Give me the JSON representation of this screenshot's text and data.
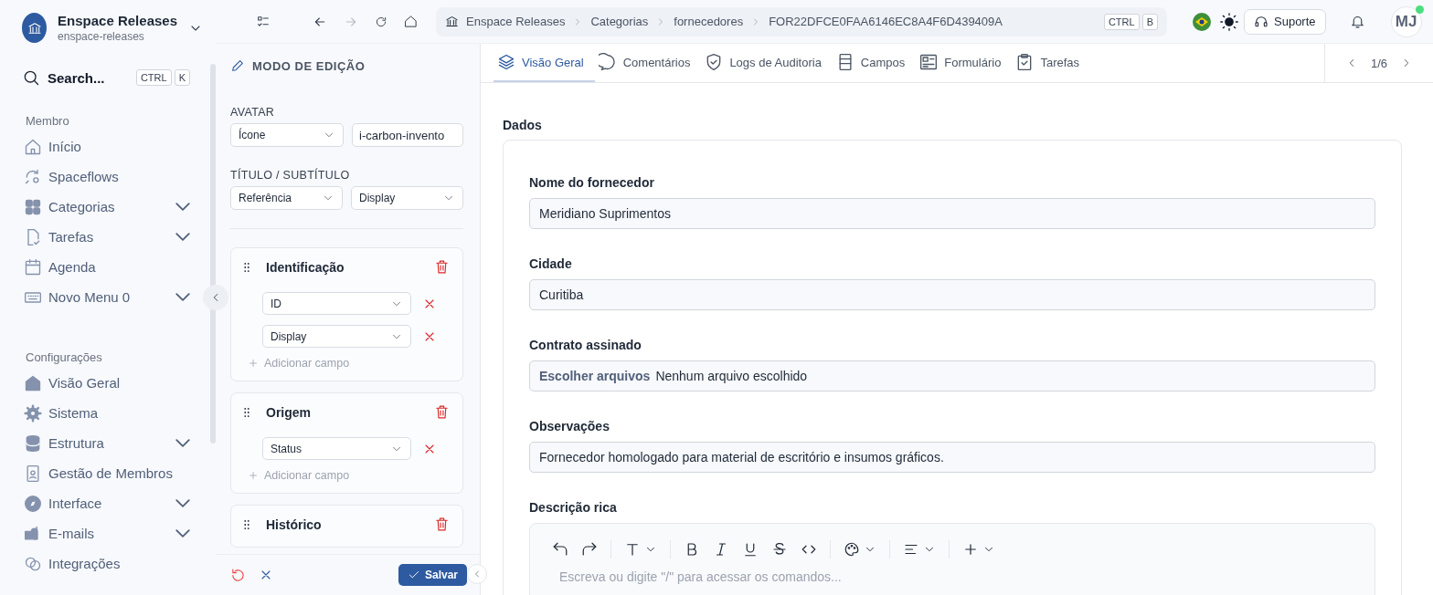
{
  "workspace": {
    "title": "Enspace Releases",
    "slug": "enspace-releases"
  },
  "search": {
    "label": "Search...",
    "keys": [
      "CTRL",
      "K"
    ]
  },
  "sidebar": {
    "groups": [
      {
        "title": "Membro",
        "items": [
          {
            "label": "Início",
            "kind": "home",
            "expandable": false
          },
          {
            "label": "Spaceflows",
            "kind": "flow",
            "expandable": false
          },
          {
            "label": "Categorias",
            "kind": "grid",
            "expandable": true
          },
          {
            "label": "Tarefas",
            "kind": "doc",
            "expandable": true
          },
          {
            "label": "Agenda",
            "kind": "calendar",
            "expandable": false
          },
          {
            "label": "Novo Menu 0",
            "kind": "keyboard",
            "expandable": true
          }
        ]
      },
      {
        "title": "Configurações",
        "items": [
          {
            "label": "Visão Geral",
            "kind": "house",
            "expandable": false
          },
          {
            "label": "Sistema",
            "kind": "gear",
            "expandable": false
          },
          {
            "label": "Estrutura",
            "kind": "database",
            "expandable": true
          },
          {
            "label": "Gestão de Membros",
            "kind": "badge",
            "expandable": false
          },
          {
            "label": "Interface",
            "kind": "compass",
            "expandable": true
          },
          {
            "label": "E-mails",
            "kind": "mailbox",
            "expandable": true
          },
          {
            "label": "Integrações",
            "kind": "link",
            "expandable": false
          }
        ]
      }
    ]
  },
  "breadcrumb": [
    "Enspace Releases",
    "Categorias",
    "fornecedores",
    "FOR22DFCE0FAA6146EC8A4F6D439409A"
  ],
  "breadcrumb_keys": [
    "CTRL",
    "B"
  ],
  "support_button": "Suporte",
  "user": {
    "initials": "MJ",
    "online": true
  },
  "editor": {
    "title": "MODO DE EDIÇÃO",
    "avatar": {
      "label": "AVATAR",
      "type": "Ícone",
      "value": "i-carbon-invento"
    },
    "title_subtitle": {
      "label": "TÍTULO / SUBTÍTULO",
      "title": "Referência",
      "subtitle": "Display"
    },
    "sections": [
      {
        "title": "Identificação",
        "fields": [
          "ID",
          "Display"
        ],
        "add_label": "Adicionar campo"
      },
      {
        "title": "Origem",
        "fields": [
          "Status"
        ],
        "add_label": "Adicionar campo"
      },
      {
        "title": "Histórico"
      }
    ],
    "save_button": "Salvar"
  },
  "tabs": [
    {
      "label": "Visão Geral",
      "kind": "layers",
      "selected": true
    },
    {
      "label": "Comentários",
      "kind": "chat",
      "selected": false
    },
    {
      "label": "Logs de Auditoria",
      "kind": "shield",
      "selected": false
    },
    {
      "label": "Campos",
      "kind": "list",
      "selected": false
    },
    {
      "label": "Formulário",
      "kind": "form",
      "selected": false
    },
    {
      "label": "Tarefas",
      "kind": "clipboard",
      "selected": false
    }
  ],
  "pager": "1/6",
  "form": {
    "title": "Dados",
    "fields": [
      {
        "label": "Nome do fornecedor",
        "kind": "text",
        "value": "Meridiano Suprimentos"
      },
      {
        "label": "Cidade",
        "kind": "text",
        "value": "Curitiba"
      },
      {
        "label": "Contrato assinado",
        "kind": "file",
        "button": "Escolher arquivos",
        "value": "Nenhum arquivo escolhido"
      },
      {
        "label": "Observações",
        "kind": "text",
        "value": "Fornecedor homologado para material de escritório e insumos gráficos."
      },
      {
        "label": "Descrição rica",
        "kind": "richtext",
        "placeholder": "Escreva ou digite \"/\" para acessar os comandos..."
      }
    ]
  }
}
